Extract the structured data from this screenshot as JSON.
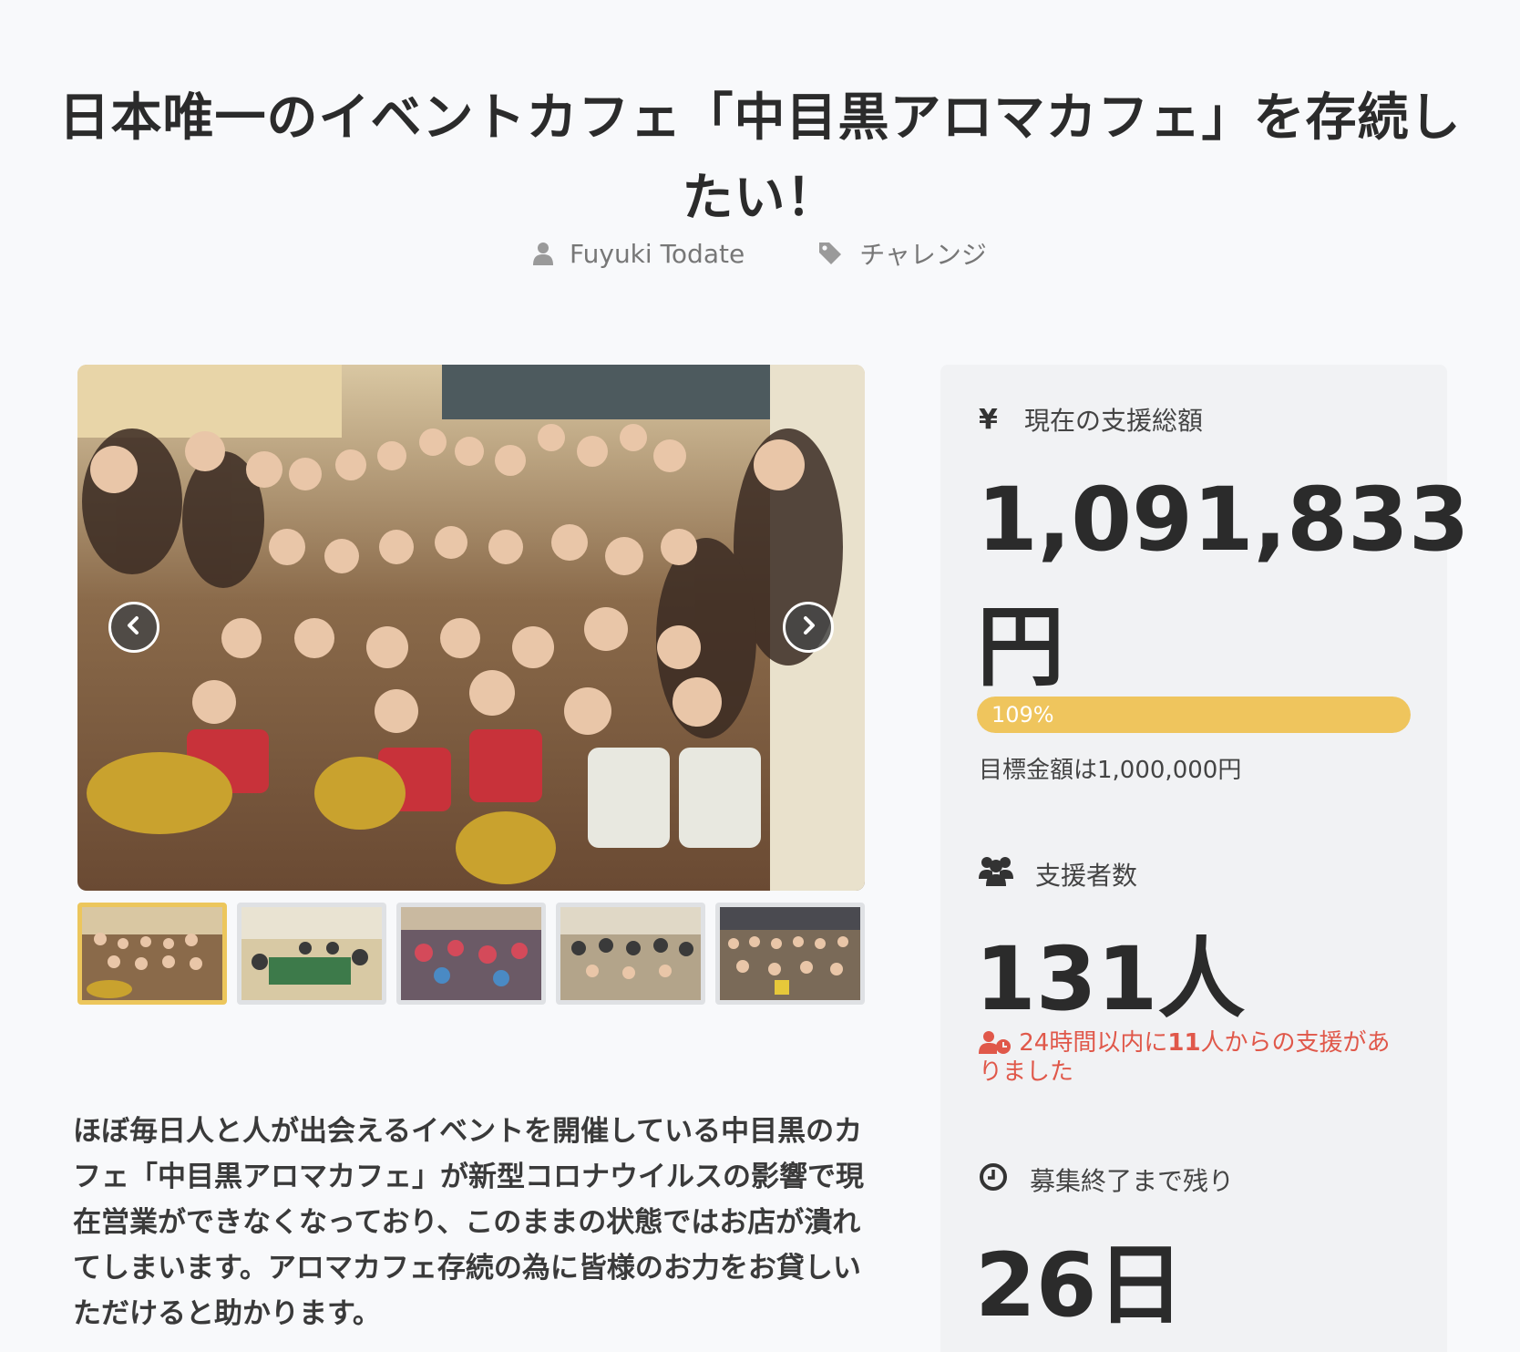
{
  "page_title": "日本唯一のイベントカフェ「中目黒アロマカフェ」を存続したい！",
  "meta": {
    "author": "Fuyuki Todate",
    "category": "チャレンジ"
  },
  "gallery": {
    "thumbnail_count": 5,
    "active_thumbnail": 1
  },
  "description": "ほぼ毎日人と人が出会えるイベントを開催している中目黒のカフェ「中目黒アロマカフェ」が新型コロナウイルスの影響で現在営業ができなくなっており、このままの状態ではお店が潰れてしまいます。アロマカフェ存続の為に皆様のお力をお貸しいただけると助かります。",
  "funding": {
    "total_label": "現在の支援総額",
    "total_amount": "1,091,833円",
    "progress_percent": 109,
    "progress_label": "109%",
    "goal_text": "目標金額は1,000,000円",
    "supporters_label": "支援者数",
    "supporters_count": "131人",
    "recent_prefix": "24時間以内に",
    "recent_count": "11",
    "recent_suffix": "人からの支援がありました",
    "remaining_label": "募集終了まで残り",
    "remaining_days": "26日"
  },
  "colors": {
    "accent": "#efc55d",
    "alert": "#e0584a",
    "panel": "#f1f2f4",
    "background": "#f8f9fb"
  },
  "icons": {
    "author": "user-icon",
    "category": "tag-icon",
    "total": "yen-icon",
    "supporters": "users-icon",
    "recent": "user-clock-icon",
    "remaining": "clock-icon",
    "gallery_prev": "chevron-left-icon",
    "gallery_next": "chevron-right-icon"
  }
}
